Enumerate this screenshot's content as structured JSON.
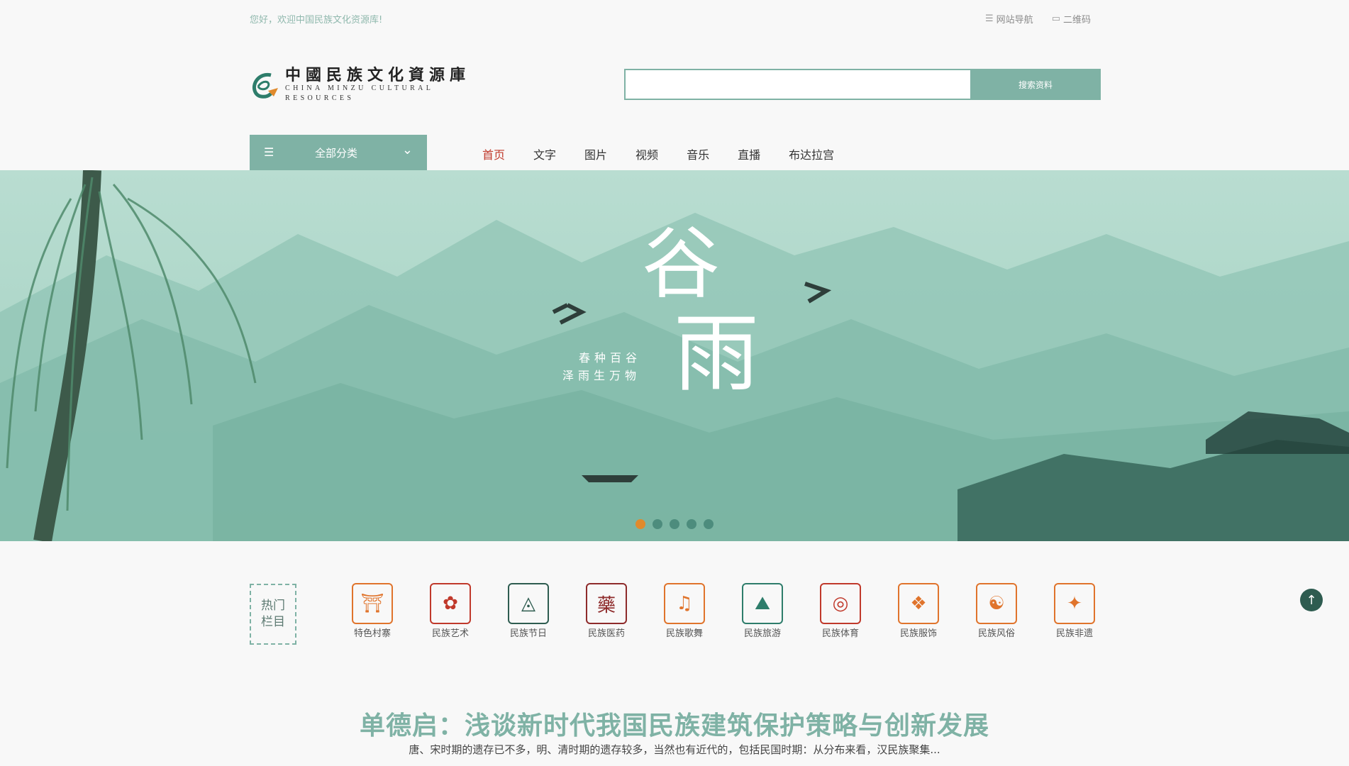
{
  "top": {
    "welcome": "您好，欢迎中国民族文化资源库!",
    "site_nav": "网站导航",
    "qrcode": "二维码"
  },
  "logo": {
    "cn": "中國民族文化資源庫",
    "en": "CHINA MINZU CULTURAL RESOURCES"
  },
  "search": {
    "placeholder": "",
    "value": "",
    "button": "搜索资料"
  },
  "category": {
    "label": "全部分类"
  },
  "nav": [
    {
      "label": "首页"
    },
    {
      "label": "文字"
    },
    {
      "label": "图片"
    },
    {
      "label": "视频"
    },
    {
      "label": "音乐"
    },
    {
      "label": "直播"
    },
    {
      "label": "布达拉宫"
    }
  ],
  "banner": {
    "title_top": "谷",
    "title_bottom": "雨",
    "line1": "春种百谷",
    "line2": "泽雨生万物",
    "active_slide": 1,
    "slide_count": 5
  },
  "hot": {
    "label_line1": "热门",
    "label_line2": "栏目"
  },
  "hot_items": [
    {
      "label": "特色村寨",
      "color": "#e0742c",
      "glyph": "⛩"
    },
    {
      "label": "民族艺术",
      "color": "#c0392b",
      "glyph": "✿"
    },
    {
      "label": "民族节日",
      "color": "#2e5c50",
      "glyph": "◬"
    },
    {
      "label": "民族医药",
      "color": "#8e2b2b",
      "glyph": "藥"
    },
    {
      "label": "民族歌舞",
      "color": "#e0742c",
      "glyph": "♫"
    },
    {
      "label": "民族旅游",
      "color": "#2e7d6b",
      "glyph": "⛰"
    },
    {
      "label": "民族体育",
      "color": "#c0392b",
      "glyph": "◎"
    },
    {
      "label": "民族服饰",
      "color": "#e0742c",
      "glyph": "❖"
    },
    {
      "label": "民族风俗",
      "color": "#e0742c",
      "glyph": "☯"
    },
    {
      "label": "民族非遗",
      "color": "#e0742c",
      "glyph": "✦"
    }
  ],
  "article": {
    "title": "单德启：浅谈新时代我国民族建筑保护策略与创新发展",
    "summary": "唐、宋时期的遗存已不多，明、清时期的遗存较多，当然也有近代的，包括民国时期：从分布来看，汉民族聚集..."
  },
  "colors": {
    "accent": "#7fb2a5",
    "active_nav": "#c0392b",
    "dot_active": "#e08a2c"
  }
}
